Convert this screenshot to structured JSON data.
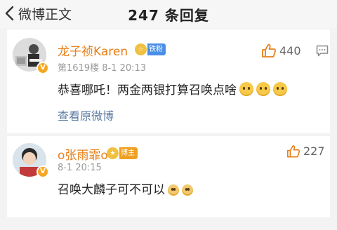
{
  "header": {
    "back_label": "微博正文",
    "title": "247 条回复"
  },
  "comments": [
    {
      "name": "龙子祯Karen",
      "badge_text": "铁粉",
      "meta": "第1619楼 8-1 20:13",
      "text": "恭喜哪吒！两金两银打算召唤点啥",
      "likes": "440",
      "link": "查看原微博"
    },
    {
      "name": "o张雨霏o",
      "badge_text": "博主",
      "meta": "8-1 20:15",
      "text": "召唤大麟子可不可以",
      "likes": "227"
    }
  ],
  "icons": {
    "back": "chevron-left-icon",
    "like": "thumbs-up-icon",
    "reply": "comment-bubble-icon"
  },
  "colors": {
    "link": "#5b7ba3",
    "username": "#e8801b",
    "badge_fan": "#4a8fe7",
    "badge_author": "#f0a020"
  }
}
